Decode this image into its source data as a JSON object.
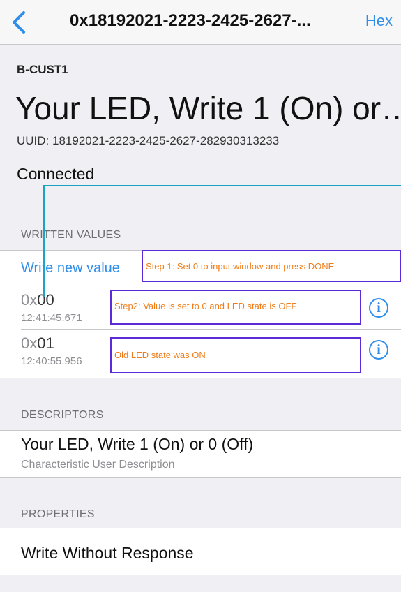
{
  "nav": {
    "title": "0x18192021-2223-2425-2627-...",
    "hex_label": "Hex"
  },
  "header": {
    "service_name": "B-CUST1",
    "characteristic_title": "Your LED, Write 1 (On) or…",
    "uuid": "UUID: 18192021-2223-2425-2627-282930313233",
    "status": "Connected"
  },
  "written": {
    "section_title": "WRITTEN VALUES",
    "write_new_label": "Write new value",
    "items": [
      {
        "prefix": "0x",
        "value": "00",
        "time": "12:41:45.671"
      },
      {
        "prefix": "0x",
        "value": "01",
        "time": "12:40:55.956"
      }
    ]
  },
  "annotations": {
    "step1": "Step 1: Set 0 to input window and press DONE",
    "step2": "Step2: Value is set to 0 and LED state is OFF",
    "old": "Old LED state was ON"
  },
  "descriptors": {
    "section_title": "DESCRIPTORS",
    "main": "Your LED, Write 1 (On) or 0 (Off)",
    "sub": "Characteristic User Description"
  },
  "properties": {
    "section_title": "PROPERTIES",
    "item": "Write Without Response"
  },
  "colors": {
    "accent": "#2f8eea",
    "annotation_border": "#5a2bd6",
    "annotation_text": "#f07d1a",
    "connector": "#1aa3c7"
  },
  "icons": {
    "back": "chevron-left-icon",
    "info": "info-icon"
  }
}
